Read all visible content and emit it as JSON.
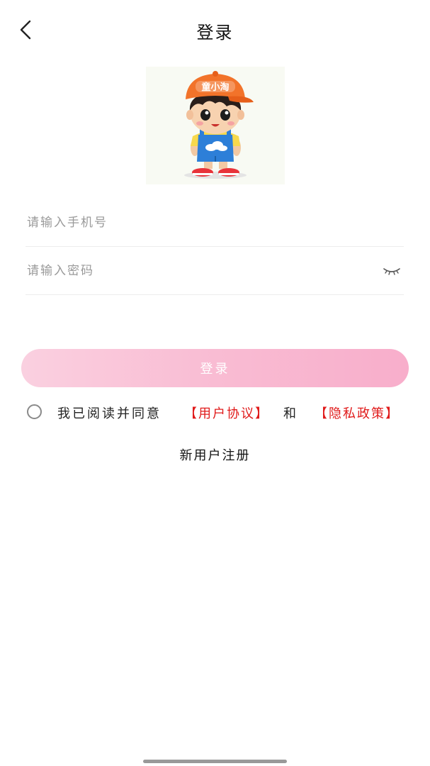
{
  "header": {
    "title": "登录",
    "back_icon": "chevron-left-icon"
  },
  "logo": {
    "badge_text": "童小淘"
  },
  "form": {
    "phone_placeholder": "请输入手机号",
    "phone_value": "",
    "password_placeholder": "请输入密码",
    "password_value": "",
    "password_toggle_icon": "eye-closed-icon",
    "login_label": "登录"
  },
  "agreement": {
    "checked": false,
    "text": "我已阅读并同意",
    "user_agreement": "【用户协议】",
    "and": "和",
    "privacy_policy": "【隐私政策】"
  },
  "register_label": "新用户注册",
  "colors": {
    "accent_pink": "#f8aecb",
    "link_red": "#e01a1a"
  }
}
